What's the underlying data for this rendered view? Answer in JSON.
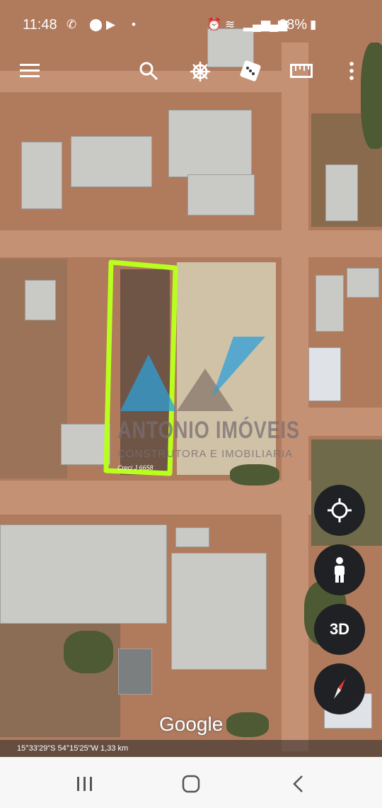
{
  "status_bar": {
    "time": "11:48",
    "battery": "68%",
    "icons_left": [
      "whatsapp-icon",
      "location-icon",
      "youtube-icon",
      "dot-icon"
    ],
    "icons_right": [
      "alarm-icon",
      "wifi-icon",
      "signal-icon",
      "signal-icon",
      "battery-icon"
    ]
  },
  "toolbar": {
    "icons": [
      "menu-icon",
      "search-icon",
      "voyager-icon",
      "feeling-lucky-icon",
      "measure-icon",
      "more-icon"
    ]
  },
  "watermark": {
    "company": "ANTONIO IMÓVEIS",
    "subtitle": "CONSTRUTORA E IMOBILIARIA",
    "license": "Creci J 6658",
    "accent_color": "#2f9fd8",
    "outline_color": "#b8ff1e"
  },
  "map_controls": {
    "three_d_label": "3D",
    "icons": [
      "my-location-icon",
      "street-view-icon",
      "compass-icon"
    ]
  },
  "map": {
    "brand": "Google",
    "coordinates": "15°33'29\"S 54°15'25\"W 1,33 km"
  },
  "nav_bar": {
    "icons": [
      "recents-icon",
      "home-icon",
      "back-icon"
    ]
  }
}
